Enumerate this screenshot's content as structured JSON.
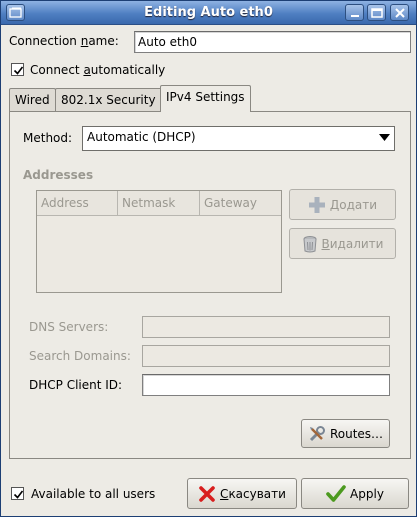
{
  "window": {
    "title": "Editing Auto eth0"
  },
  "connection": {
    "name_label": "Connection ",
    "name_label_underlined": "n",
    "name_label_rest": "ame:",
    "name_value": "Auto eth0"
  },
  "auto_connect": {
    "label_prefix": "Connect ",
    "label_underlined": "a",
    "label_rest": "utomatically",
    "checked": true
  },
  "tabs": [
    {
      "label": "Wired",
      "active": false
    },
    {
      "label": "802.1x Security",
      "active": false
    },
    {
      "label": "IPv4 Settings",
      "active": true
    }
  ],
  "ipv4": {
    "method_label": "Method:",
    "method_value": "Automatic (DHCP)",
    "addresses_title": "Addresses",
    "columns": [
      "Address",
      "Netmask",
      "Gateway"
    ],
    "add_button": {
      "underlined": "Д",
      "rest": "одати"
    },
    "delete_button": {
      "underlined": "В",
      "rest": "идалити"
    },
    "dns_label": "DNS Servers:",
    "search_label": "Search Domains:",
    "dhcp_label": "DHCP Client ID:",
    "dns_value": "",
    "search_value": "",
    "dhcp_value": "",
    "routes_button": "Routes…"
  },
  "footer": {
    "available_label": "Available to all users",
    "available_checked": true,
    "cancel_button": {
      "underlined": "С",
      "rest": "касувати"
    },
    "apply_button": "Apply"
  },
  "colors": {
    "titlebar": "#4f7fc2",
    "cancel_icon": "#d81e1e",
    "apply_icon": "#4c9a1f",
    "window_bg": "#edebe5"
  }
}
